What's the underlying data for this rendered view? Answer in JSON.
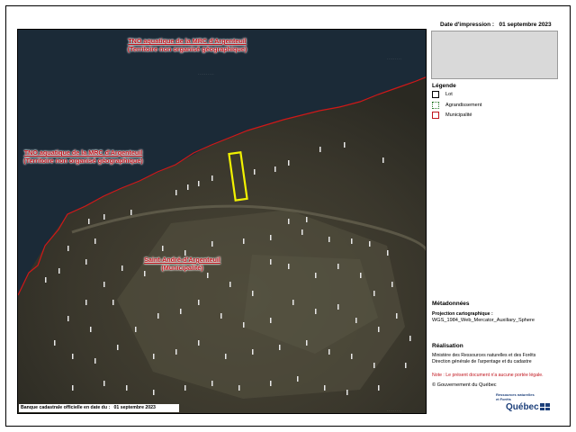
{
  "header": {
    "print_date_label": "Date d'impression :",
    "print_date_value": "01 septembre 2023"
  },
  "map": {
    "labels": {
      "tno_top_line1": "TNO aquatique de la MRC d'Argenteuil",
      "tno_top_line2": "(Territoire non organisé géographique)",
      "tno_left_line1": "TNO aquatique de la MRC d'Argenteuil",
      "tno_left_line2": "(Territoire non organisé géographique)",
      "muni_line1": "Saint-André-d'Argenteuil",
      "muni_line2": "(Municipalité)"
    },
    "colors": {
      "water": "#1b2c3a",
      "land": "#3f3b30",
      "municipality_line": "#d01818",
      "selected_lot": "#f2f200"
    },
    "banque_label": "Banque cadastrale officielle en date du :",
    "banque_date": "01 septembre 2023"
  },
  "legend": {
    "title": "Légende",
    "items": [
      {
        "label": "Lot",
        "icon": "lot-symbol"
      },
      {
        "label": "Agrandissement",
        "icon": "enlargement-symbol"
      },
      {
        "label": "Municipalité",
        "icon": "municipality-symbol"
      }
    ]
  },
  "metadata": {
    "title": "Métadonnées",
    "projection_label": "Projection cartographique :",
    "projection_value": "WGS_1984_Web_Mercator_Auxiliary_Sphere"
  },
  "realisation": {
    "title": "Réalisation",
    "line1": "Ministère des Ressources naturelles et des Forêts",
    "line2": "Direction générale de l'arpentage et du cadastre"
  },
  "note": "Note : Le présent document n'a aucune portée légale.",
  "copyright": "© Gouvernement du Québec",
  "logo": {
    "line1": "Ressources naturelles",
    "line2": "et Forêts",
    "word": "Québec"
  }
}
